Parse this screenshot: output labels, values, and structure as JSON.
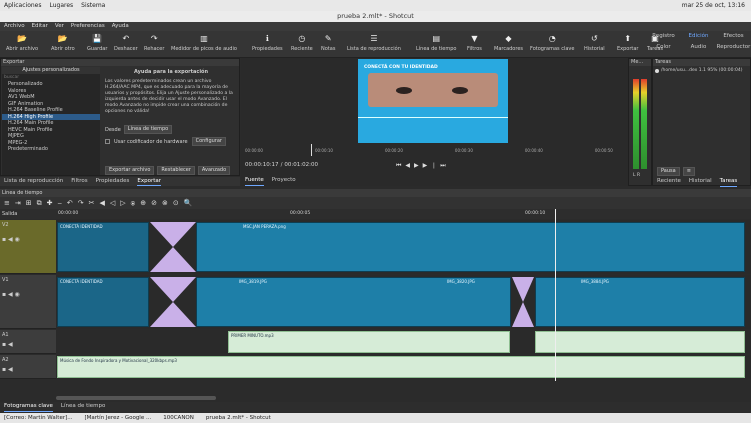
{
  "topbar": {
    "apps": "Aplicaciones",
    "places": "Lugares",
    "system": "Sistema",
    "clock": "mar 25 de oct, 13:16"
  },
  "window": {
    "title": "prueba 2.mlt* - Shotcut"
  },
  "menu": [
    "Archivo",
    "Editar",
    "Ver",
    "Preferencias",
    "Ayuda"
  ],
  "toolbar": [
    {
      "name": "open-file",
      "label": "Abrir archivo",
      "icon": "folder-icon"
    },
    {
      "name": "open-other",
      "label": "Abrir otro",
      "icon": "folder-icon"
    },
    {
      "name": "save",
      "label": "Guardar",
      "icon": "save-icon"
    },
    {
      "name": "undo",
      "label": "Deshacer",
      "icon": "undo-icon"
    },
    {
      "name": "redo",
      "label": "Rehacer",
      "icon": "redo-icon"
    },
    {
      "name": "peak-meter",
      "label": "Medidor de picos de audio",
      "icon": "meter-icon"
    },
    {
      "name": "properties",
      "label": "Propiedades",
      "icon": "info-icon"
    },
    {
      "name": "recent",
      "label": "Reciente",
      "icon": "clock-icon"
    },
    {
      "name": "notes",
      "label": "Notas",
      "icon": "note-icon"
    },
    {
      "name": "playlist",
      "label": "Lista de reproducción",
      "icon": "list-icon"
    },
    {
      "name": "timeline",
      "label": "Línea de tiempo",
      "icon": "timeline-icon"
    },
    {
      "name": "filters",
      "label": "Filtros",
      "icon": "filter-icon"
    },
    {
      "name": "markers",
      "label": "Marcadores",
      "icon": "marker-icon"
    },
    {
      "name": "keyframes",
      "label": "Fotogramas clave",
      "icon": "keyframe-icon"
    },
    {
      "name": "history",
      "label": "Historial",
      "icon": "history-icon"
    },
    {
      "name": "export",
      "label": "Exportar",
      "icon": "export-icon"
    },
    {
      "name": "jobs",
      "label": "Tareas",
      "icon": "jobs-icon"
    }
  ],
  "layouts": [
    "Registro",
    "Edición",
    "Efectos",
    "Color",
    "Audio",
    "Reproductor"
  ],
  "export_panel": {
    "header": "Exportar",
    "presets_title": "Ajustes personalizados",
    "search_placeholder": "buscar",
    "items": [
      "Personalizado",
      "Valores",
      "AV1 WebM",
      "GIF Animation",
      "H.264 Baseline Profile",
      "H.264 High Profile",
      "H.264 Main Profile",
      "HEVC Main Profile",
      "MJPEG",
      "MPEG-2",
      "Predeterminado"
    ],
    "selected": "H.264 High Profile",
    "help_title": "Ayuda para la exportación",
    "help_text": "Los valores predeterminados crean un archivo H.264/AAC MP4, que es adecuado para la mayoría de usuarios y propósitos. Elija un Ajuste personalizado a la izquierda antes de decidir usar el modo Avanzado. El modo Avanzado no impide crear una combinación de opciones no válida!",
    "from_label": "Desde",
    "from_value": "Línea de tiempo",
    "hw_label": "Usar codificador de hardware",
    "configure": "Configurar",
    "export_btn": "Exportar archivo",
    "reset_btn": "Restablecer",
    "advanced_btn": "Avanzado"
  },
  "left_tabs": [
    "Lista de reproducción",
    "Filtros",
    "Propiedades",
    "Exportar"
  ],
  "player": {
    "caption": "CONECTÁ CON TU IDENTIDAD",
    "timecode": "00:00:10:17",
    "duration": "00:01:02:00",
    "ruler": [
      "00:00:00",
      "00:00:10",
      "00:00:20",
      "00:00:30",
      "00:00:40",
      "00:00:50"
    ],
    "tabs": [
      "Fuente",
      "Proyecto"
    ]
  },
  "meter": {
    "label": "Me...",
    "scale": [
      "0",
      "-5",
      "-10",
      "-15",
      "-20",
      "-25",
      "-30",
      "-35",
      "-40",
      "-50"
    ],
    "channels": "L R"
  },
  "jobs": {
    "header": "Tareas",
    "item": "/home/usu...dex 1.1 95% (00:00:04)",
    "pause": "Pausa",
    "tabs": [
      "Reciente",
      "Historial",
      "Tareas"
    ]
  },
  "timeline": {
    "header": "Línea de tiempo",
    "output": "Salida",
    "ruler": [
      "00:00:00",
      "00:00:05",
      "00:00:10"
    ],
    "tracks": [
      {
        "name": "V2"
      },
      {
        "name": "V1"
      },
      {
        "name": "A1"
      },
      {
        "name": "A2"
      }
    ],
    "clips": {
      "v2_a": "CONECTÁ IDENTIDAD",
      "v2_b": "MSC.JAN PERAZA.png",
      "v1_a": "CONECTÁ IDENTIDAD",
      "v1_b": "IMG_3819.JPG",
      "v1_c": "IMG_3820.JPG",
      "v1_d": "IMG_3884.JPG",
      "a1": "PRIMER MINUTO.mp3",
      "a2": "Música de Fondo Inspiradora y Motivacional_320kbps.mp3"
    }
  },
  "bottom_tabs": [
    "Fotogramas clave",
    "Línea de tiempo"
  ],
  "statusbar": [
    "[Correo: Martín Walter]...",
    "[Martín Jerez - Google ...",
    "100CANON",
    "prueba 2.mlt* - Shotcut"
  ]
}
